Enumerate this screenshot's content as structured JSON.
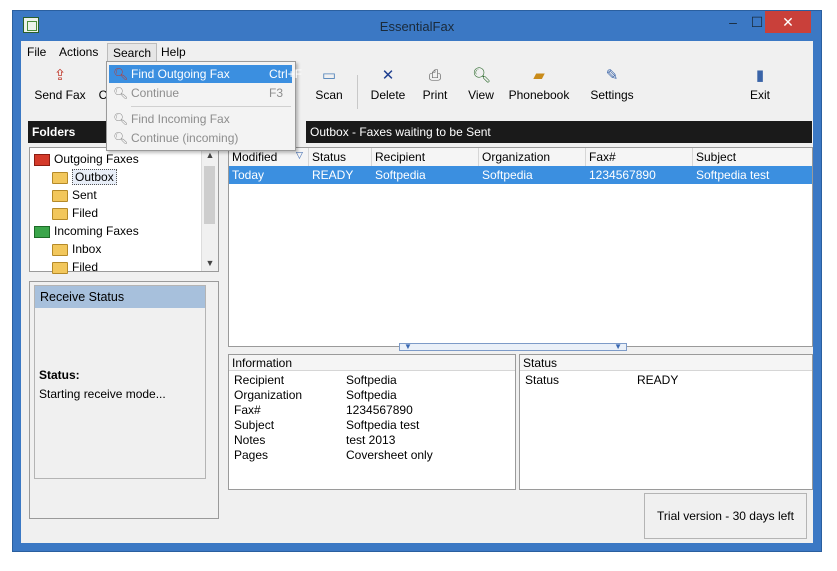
{
  "window": {
    "title": "EssentialFax",
    "min": "–",
    "max": "☐",
    "close": "✕"
  },
  "menu": {
    "file": "File",
    "actions": "Actions",
    "search": "Search",
    "help": "Help"
  },
  "toolbar": {
    "send_fax": "Send Fax",
    "cover": "C",
    "scan": "Scan",
    "delete": "Delete",
    "print": "Print",
    "view": "View",
    "phonebook": "Phonebook",
    "settings": "Settings",
    "exit": "Exit"
  },
  "folders": {
    "header": "Folders",
    "path": "Outbox - Faxes waiting to be Sent",
    "items": [
      {
        "label": "Outgoing Faxes",
        "icon": "outgoing-tray-icon"
      },
      {
        "label": "Outbox",
        "icon": "folder-open-icon"
      },
      {
        "label": "Sent",
        "icon": "folder-icon"
      },
      {
        "label": "Filed",
        "icon": "folder-icon"
      },
      {
        "label": "Incoming Faxes",
        "icon": "incoming-tray-icon"
      },
      {
        "label": "Inbox",
        "icon": "folder-icon"
      },
      {
        "label": "Filed",
        "icon": "folder-icon"
      }
    ]
  },
  "receive": {
    "title": "Receive Status",
    "status_label": "Status:",
    "status_text": "Starting receive mode..."
  },
  "grid": {
    "columns": [
      "Modified",
      "Status",
      "Recipient",
      "Organization",
      "Fax#",
      "Subject"
    ],
    "rows": [
      {
        "modified": "Today",
        "status": "READY",
        "recipient": "Softpedia",
        "organization": "Softpedia",
        "fax": "1234567890",
        "subject": "Softpedia test"
      }
    ]
  },
  "info": {
    "title": "Information",
    "rows": [
      {
        "key": "Recipient",
        "value": "Softpedia"
      },
      {
        "key": "Organization",
        "value": "Softpedia"
      },
      {
        "key": "Fax#",
        "value": "1234567890"
      },
      {
        "key": "Subject",
        "value": "Softpedia test"
      },
      {
        "key": "Notes",
        "value": "test 2013"
      },
      {
        "key": "Pages",
        "value": "Coversheet only"
      }
    ]
  },
  "status_panel": {
    "title": "Status",
    "key": "Status",
    "value": "READY"
  },
  "trial": "Trial version - 30 days left",
  "search_menu": {
    "find_outgoing": "Find Outgoing Fax",
    "find_outgoing_shortcut": "Ctrl+F",
    "continue": "Continue",
    "continue_shortcut": "F3",
    "find_incoming": "Find Incoming Fax",
    "continue_incoming": "Continue (incoming)"
  },
  "colors": {
    "titlebar": "#3b78c4",
    "selection": "#3b8fe0",
    "close": "#c9403a"
  }
}
